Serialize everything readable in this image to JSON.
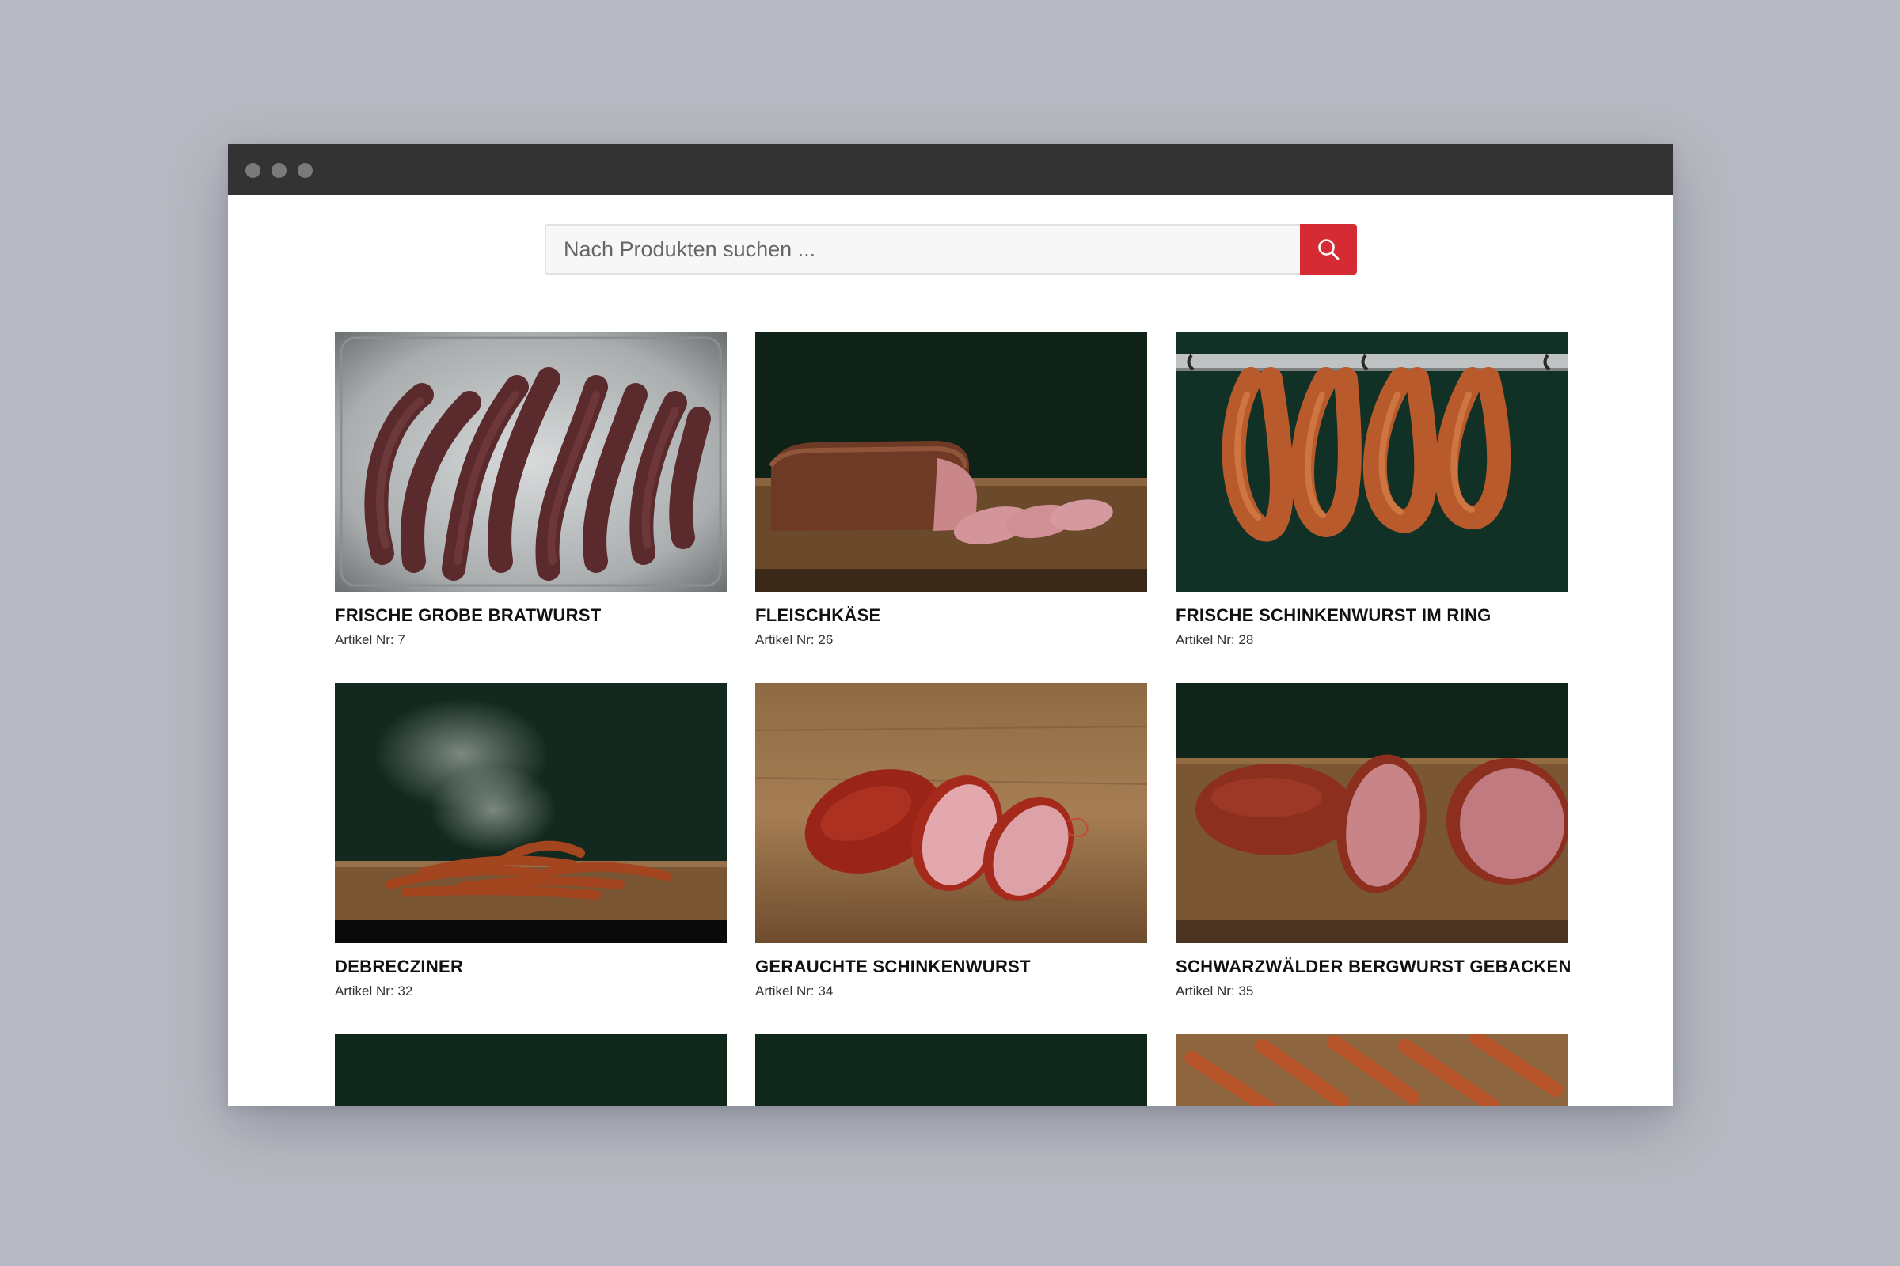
{
  "search": {
    "placeholder": "Nach Produkten suchen ...",
    "icon": "search-icon"
  },
  "colors": {
    "accent": "#d52b35",
    "titlebar": "#333333",
    "page_background": "#b7bac2"
  },
  "products": [
    {
      "title": "FRISCHE GROBE BRATWURST",
      "artikel_label": "Artikel Nr:",
      "artikel_nr": "7"
    },
    {
      "title": "FLEISCHKÄSE",
      "artikel_label": "Artikel Nr:",
      "artikel_nr": "26"
    },
    {
      "title": "FRISCHE SCHINKENWURST IM RING",
      "artikel_label": "Artikel Nr:",
      "artikel_nr": "28"
    },
    {
      "title": "DEBRECZINER",
      "artikel_label": "Artikel Nr:",
      "artikel_nr": "32"
    },
    {
      "title": "GERAUCHTE SCHINKENWURST",
      "artikel_label": "Artikel Nr:",
      "artikel_nr": "34"
    },
    {
      "title": "SCHWARZWÄLDER BERGWURST GEBACKEN",
      "artikel_label": "Artikel Nr:",
      "artikel_nr": "35"
    }
  ]
}
